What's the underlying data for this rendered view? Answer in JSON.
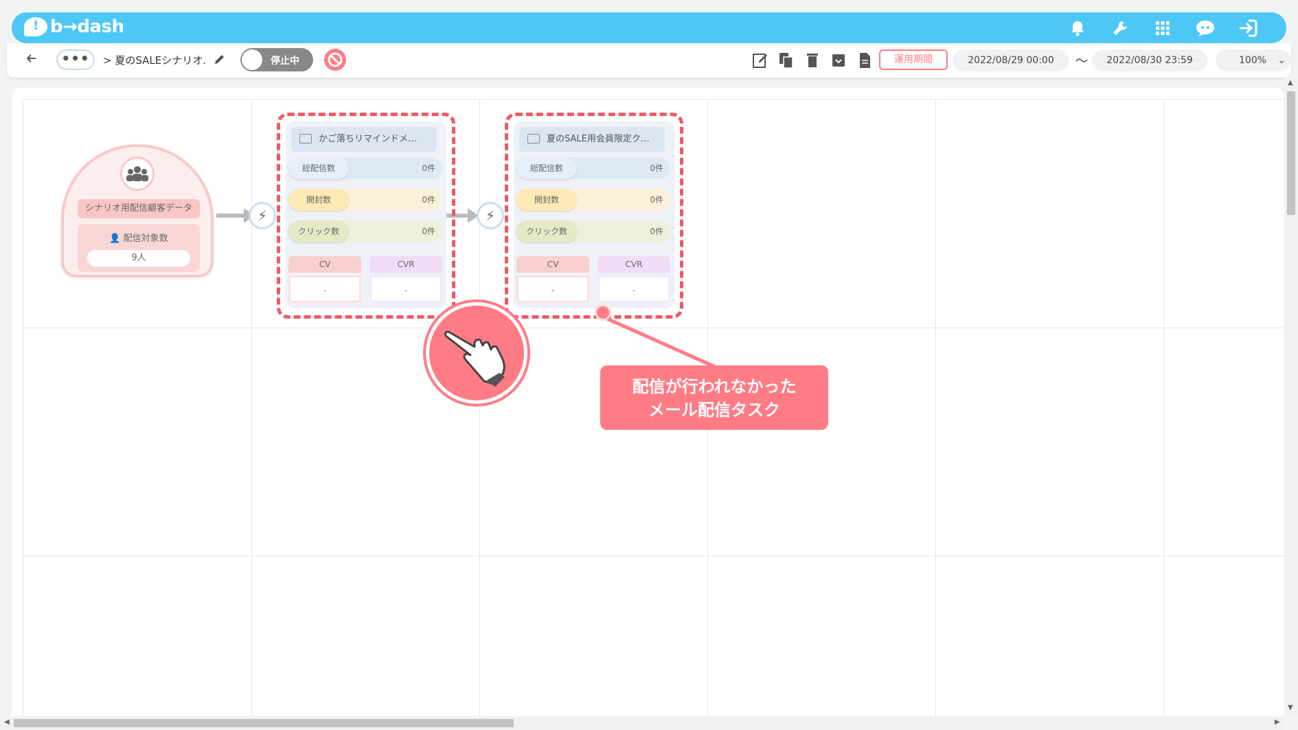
{
  "app": {
    "logo_text": "b→dash"
  },
  "header_icons": [
    "bell-icon",
    "wrench-icon",
    "apps-grid-icon",
    "chat-bot-icon",
    "logout-icon"
  ],
  "toolbar": {
    "more_label": "•••",
    "breadcrumb": "> 夏のSALEシナリオ.",
    "toggle_label": "停止中",
    "period_label": "運用期間",
    "start_date": "2022/08/29 00:00",
    "tilde": "〜",
    "end_date": "2022/08/30 23:59",
    "zoom": "100%"
  },
  "start_node": {
    "title": "シナリオ用配信顧客データ",
    "target_label": "配信対象数",
    "target_value": "9人"
  },
  "tasks": [
    {
      "title": "かご落ちリマインドメ…",
      "total_label": "総配信数",
      "total_value": "0件",
      "open_label": "開封数",
      "open_value": "0件",
      "click_label": "クリック数",
      "click_value": "0件",
      "cv_label": "CV",
      "cvr_label": "CVR",
      "cv_value": "-",
      "cvr_value": "-"
    },
    {
      "title": "夏のSALE用会員限定ク…",
      "total_label": "総配信数",
      "total_value": "0件",
      "open_label": "開封数",
      "open_value": "0件",
      "click_label": "クリック数",
      "click_value": "0件",
      "cv_label": "CV",
      "cvr_label": "CVR",
      "cv_value": "-",
      "cvr_value": "-"
    }
  ],
  "callout": {
    "line1": "配信が行われなかった",
    "line2": "メール配信タスク"
  },
  "colors": {
    "header": "#4dc8f5",
    "accent": "#ff7b85",
    "dash_border": "#ef5a66"
  }
}
